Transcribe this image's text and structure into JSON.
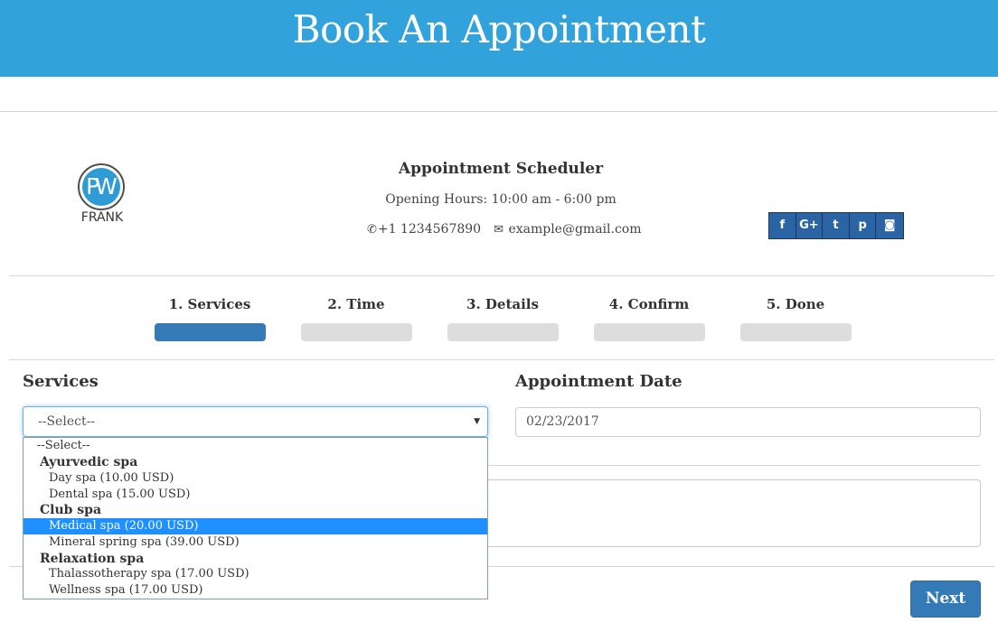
{
  "banner": {
    "title": "Book An Appointment"
  },
  "business": {
    "logo_text": "FRANK",
    "name": "Appointment Scheduler",
    "hours": "Opening Hours: 10:00 am - 6:00 pm",
    "phone": "+1 1234567890",
    "email": "example@gmail.com"
  },
  "social": [
    {
      "icon": "facebook-icon",
      "glyph": "f"
    },
    {
      "icon": "google-plus-icon",
      "glyph": "G+"
    },
    {
      "icon": "twitter-icon",
      "glyph": "t"
    },
    {
      "icon": "pinterest-icon",
      "glyph": "p"
    },
    {
      "icon": "instagram-icon",
      "glyph": "◙"
    }
  ],
  "steps": [
    {
      "label": "1. Services",
      "active": true
    },
    {
      "label": "2. Time",
      "active": false
    },
    {
      "label": "3. Details",
      "active": false
    },
    {
      "label": "4. Confirm",
      "active": false
    },
    {
      "label": "5. Done",
      "active": false
    }
  ],
  "form": {
    "services_label": "Services",
    "services_value": "--Select--",
    "date_label": "Appointment Date",
    "date_value": "02/23/2017"
  },
  "dropdown": {
    "options": [
      {
        "type": "placeholder",
        "text": "--Select--"
      },
      {
        "type": "group",
        "text": "Ayurvedic spa"
      },
      {
        "type": "option",
        "text": "Day spa (10.00 USD)"
      },
      {
        "type": "option",
        "text": "Dental spa (15.00 USD)"
      },
      {
        "type": "group",
        "text": "Club spa"
      },
      {
        "type": "option",
        "text": "Medical spa (20.00 USD)",
        "selected": true
      },
      {
        "type": "option",
        "text": "Mineral spring spa (39.00 USD)"
      },
      {
        "type": "group",
        "text": "Relaxation spa"
      },
      {
        "type": "option",
        "text": "Thalassotherapy spa (17.00 USD)"
      },
      {
        "type": "option",
        "text": "Wellness spa (17.00 USD)"
      }
    ]
  },
  "actions": {
    "next_label": "Next"
  },
  "colors": {
    "banner": "#31a2dc",
    "primary": "#337ab7",
    "highlight": "#1e90ff"
  }
}
